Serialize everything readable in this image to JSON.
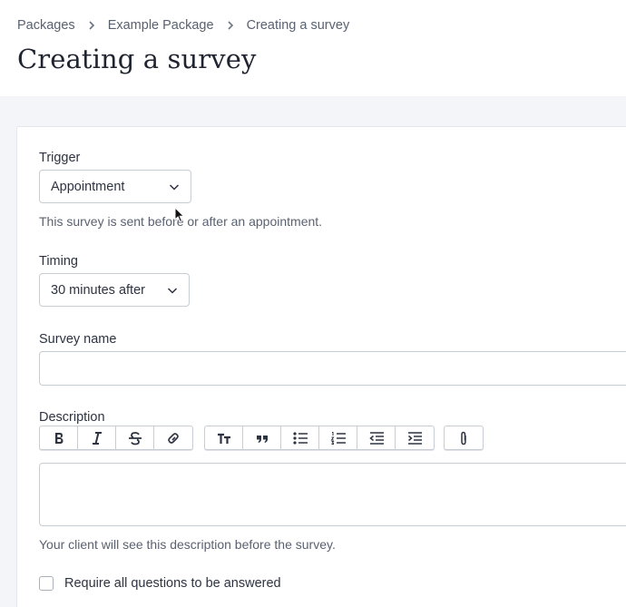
{
  "breadcrumb": {
    "items": [
      "Packages",
      "Example Package",
      "Creating a survey"
    ]
  },
  "page": {
    "title": "Creating a survey"
  },
  "trigger": {
    "label": "Trigger",
    "value": "Appointment",
    "help": "This survey is sent before or after an appointment."
  },
  "timing": {
    "label": "Timing",
    "value": "30 minutes after"
  },
  "survey_name": {
    "label": "Survey name",
    "value": ""
  },
  "description": {
    "label": "Description",
    "value": "",
    "help": "Your client will see this description before the survey."
  },
  "toolbar": {
    "icons": [
      "bold-icon",
      "italic-icon",
      "strikethrough-icon",
      "link-icon",
      "heading-icon",
      "quote-icon",
      "bullet-list-icon",
      "numbered-list-icon",
      "outdent-icon",
      "indent-icon",
      "attachment-icon"
    ]
  },
  "require_all": {
    "label": "Require all questions to be answered",
    "checked": false
  },
  "colors": {
    "background": "#f4f5f9",
    "border": "#c8ccd4",
    "text": "#2d3340",
    "muted": "#5a6170"
  }
}
